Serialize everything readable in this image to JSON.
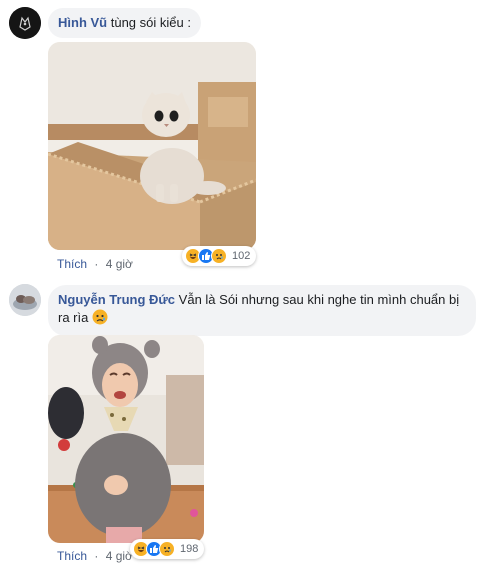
{
  "comments": [
    {
      "author": "Hình Vũ",
      "text": "tùng sói kiểu :",
      "text_cont": "",
      "like_label": "Thích",
      "separator": "·",
      "time": "4 giờ",
      "reaction_count": "102",
      "reaction_icons": [
        "haha-icon",
        "like-icon",
        "sad-icon"
      ]
    },
    {
      "author": "Nguyễn Trung Đức",
      "text": "Vẫn là Sói nhưng sau khi nghe tin mình chuẩn bị",
      "text_cont": "ra rìa",
      "like_label": "Thích",
      "separator": "·",
      "time": "4 giờ",
      "reaction_count": "198",
      "reaction_icons": [
        "haha-icon",
        "like-icon",
        "sad-icon"
      ]
    }
  ],
  "colors": {
    "author": "#385898",
    "bubble": "#f2f3f5",
    "meta": "#606770",
    "like_reaction": "#1877f2",
    "emoji_yellow": "#f7b125"
  }
}
